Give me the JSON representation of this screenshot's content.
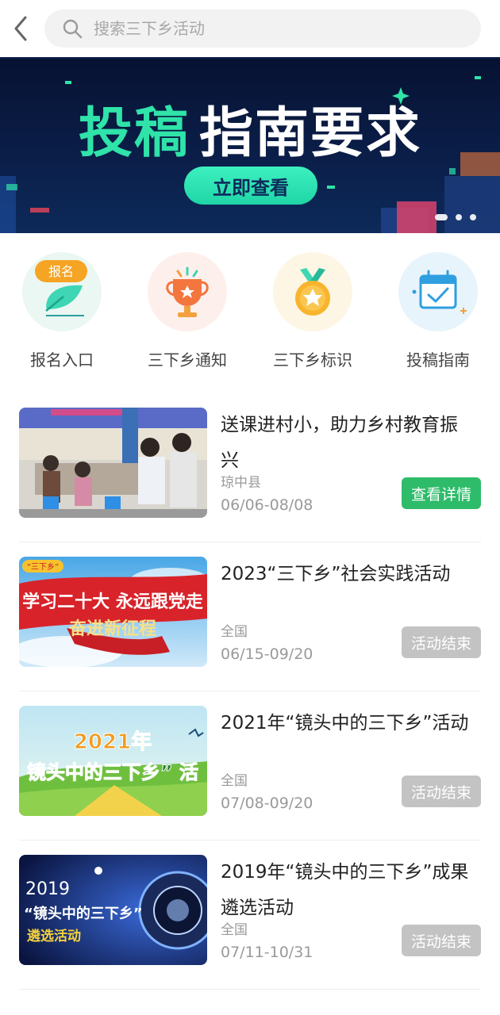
{
  "search": {
    "placeholder": "搜索三下乡活动"
  },
  "banner": {
    "title_part1": "投稿",
    "title_part2": "指南要求",
    "button_label": "立即查看"
  },
  "quick_entries": [
    {
      "label": "报名入口",
      "badge": "报名",
      "icon": "feather-icon"
    },
    {
      "label": "三下乡通知",
      "icon": "trophy-icon"
    },
    {
      "label": "三下乡标识",
      "icon": "medal-icon"
    },
    {
      "label": "投稿指南",
      "icon": "calendar-check-icon"
    }
  ],
  "activities": [
    {
      "title": "送课进村小，助力乡村教育振兴",
      "location": "琼中县",
      "date": "06/06-08/08",
      "button": "查看详情",
      "status": "active"
    },
    {
      "title": "2023“三下乡”社会实践活动",
      "location": "全国",
      "date": "06/15-09/20",
      "button": "活动结束",
      "status": "ended",
      "thumb_tag": "“三下乡”",
      "thumb_line1": "学习二十大 永远跟党走",
      "thumb_line2": "奋进新征程"
    },
    {
      "title": "2021年“镜头中的三下乡”活动",
      "location": "全国",
      "date": "07/08-09/20",
      "button": "活动结束",
      "status": "ended",
      "thumb_line1": "2021年",
      "thumb_line2": "镜头中的三下乡” 活"
    },
    {
      "title": "2019年“镜头中的三下乡”成果遴选活动",
      "location": "全国",
      "date": "07/11-10/31",
      "button": "活动结束",
      "status": "ended",
      "thumb_line1": "2019",
      "thumb_line2": "“镜头中的三下乡”",
      "thumb_line3": "遴选活动"
    }
  ],
  "colors": {
    "accent_green": "#2ebc6a",
    "ended_gray": "#c3c3c3",
    "banner_teal": "#2fe3a9"
  }
}
